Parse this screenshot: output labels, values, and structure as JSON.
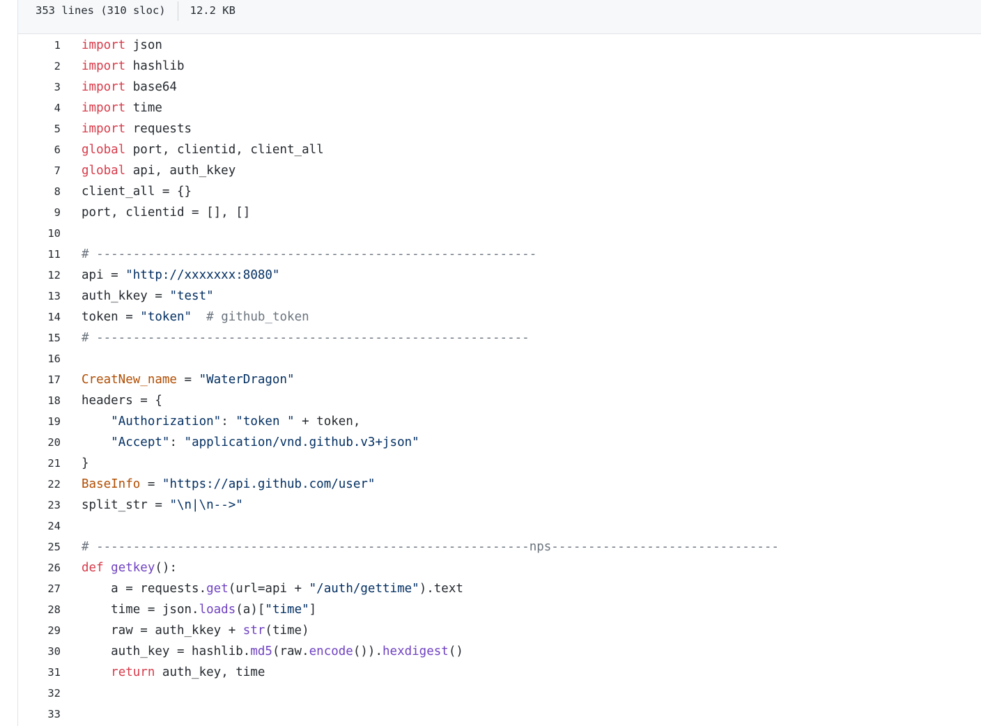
{
  "file_info": {
    "lines": "353 lines (310 sloc)",
    "size": "12.2 KB"
  },
  "code_lines": [
    {
      "n": "1",
      "tokens": [
        [
          "kw",
          "import"
        ],
        [
          "p",
          " json"
        ]
      ]
    },
    {
      "n": "2",
      "tokens": [
        [
          "kw",
          "import"
        ],
        [
          "p",
          " hashlib"
        ]
      ]
    },
    {
      "n": "3",
      "tokens": [
        [
          "kw",
          "import"
        ],
        [
          "p",
          " base64"
        ]
      ]
    },
    {
      "n": "4",
      "tokens": [
        [
          "kw",
          "import"
        ],
        [
          "p",
          " time"
        ]
      ]
    },
    {
      "n": "5",
      "tokens": [
        [
          "kw",
          "import"
        ],
        [
          "p",
          " requests"
        ]
      ]
    },
    {
      "n": "6",
      "tokens": [
        [
          "kw",
          "global"
        ],
        [
          "p",
          " port, clientid, client_all"
        ]
      ]
    },
    {
      "n": "7",
      "tokens": [
        [
          "kw",
          "global"
        ],
        [
          "p",
          " api, auth_kkey"
        ]
      ]
    },
    {
      "n": "8",
      "tokens": [
        [
          "p",
          "client_all = {}"
        ]
      ]
    },
    {
      "n": "9",
      "tokens": [
        [
          "p",
          "port, clientid = [], []"
        ]
      ]
    },
    {
      "n": "10",
      "tokens": []
    },
    {
      "n": "11",
      "tokens": [
        [
          "com",
          "# ------------------------------------------------------------"
        ]
      ]
    },
    {
      "n": "12",
      "tokens": [
        [
          "p",
          "api = "
        ],
        [
          "str",
          "\"http://xxxxxxx:8080\""
        ]
      ]
    },
    {
      "n": "13",
      "tokens": [
        [
          "p",
          "auth_kkey = "
        ],
        [
          "str",
          "\"test\""
        ]
      ]
    },
    {
      "n": "14",
      "tokens": [
        [
          "p",
          "token = "
        ],
        [
          "str",
          "\"token\""
        ],
        [
          "p",
          "  "
        ],
        [
          "com",
          "# github_token"
        ]
      ]
    },
    {
      "n": "15",
      "tokens": [
        [
          "com",
          "# -----------------------------------------------------------"
        ]
      ]
    },
    {
      "n": "16",
      "tokens": []
    },
    {
      "n": "17",
      "tokens": [
        [
          "var2",
          "CreatNew_name"
        ],
        [
          "p",
          " = "
        ],
        [
          "str",
          "\"WaterDragon\""
        ]
      ]
    },
    {
      "n": "18",
      "tokens": [
        [
          "p",
          "headers = {"
        ]
      ]
    },
    {
      "n": "19",
      "tokens": [
        [
          "p",
          "    "
        ],
        [
          "str",
          "\"Authorization\""
        ],
        [
          "p",
          ": "
        ],
        [
          "str",
          "\"token \""
        ],
        [
          "p",
          " + token,"
        ]
      ]
    },
    {
      "n": "20",
      "tokens": [
        [
          "p",
          "    "
        ],
        [
          "str",
          "\"Accept\""
        ],
        [
          "p",
          ": "
        ],
        [
          "str",
          "\"application/vnd.github.v3+json\""
        ]
      ]
    },
    {
      "n": "21",
      "tokens": [
        [
          "p",
          "}"
        ]
      ]
    },
    {
      "n": "22",
      "tokens": [
        [
          "var2",
          "BaseInfo"
        ],
        [
          "p",
          " = "
        ],
        [
          "str",
          "\"https://api.github.com/user\""
        ]
      ]
    },
    {
      "n": "23",
      "tokens": [
        [
          "p",
          "split_str = "
        ],
        [
          "str",
          "\"\\n|\\n-->\""
        ]
      ]
    },
    {
      "n": "24",
      "tokens": []
    },
    {
      "n": "25",
      "tokens": [
        [
          "com",
          "# -----------------------------------------------------------nps-------------------------------"
        ]
      ]
    },
    {
      "n": "26",
      "tokens": [
        [
          "kw",
          "def"
        ],
        [
          "p",
          " "
        ],
        [
          "fn",
          "getkey"
        ],
        [
          "p",
          "():"
        ]
      ]
    },
    {
      "n": "27",
      "tokens": [
        [
          "p",
          "    a = requests."
        ],
        [
          "fn",
          "get"
        ],
        [
          "p",
          "(url=api + "
        ],
        [
          "str",
          "\"/auth/gettime\""
        ],
        [
          "p",
          ").text"
        ]
      ]
    },
    {
      "n": "28",
      "tokens": [
        [
          "p",
          "    time = json."
        ],
        [
          "fn",
          "loads"
        ],
        [
          "p",
          "(a)["
        ],
        [
          "str",
          "\"time\""
        ],
        [
          "p",
          "]"
        ]
      ]
    },
    {
      "n": "29",
      "tokens": [
        [
          "p",
          "    raw = auth_kkey + "
        ],
        [
          "fn",
          "str"
        ],
        [
          "p",
          "(time)"
        ]
      ]
    },
    {
      "n": "30",
      "tokens": [
        [
          "p",
          "    auth_key = hashlib."
        ],
        [
          "fn",
          "md5"
        ],
        [
          "p",
          "(raw."
        ],
        [
          "fn",
          "encode"
        ],
        [
          "p",
          "())."
        ],
        [
          "fn",
          "hexdigest"
        ],
        [
          "p",
          "()"
        ]
      ]
    },
    {
      "n": "31",
      "tokens": [
        [
          "p",
          "    "
        ],
        [
          "kw",
          "return"
        ],
        [
          "p",
          " auth_key, time"
        ]
      ]
    },
    {
      "n": "32",
      "tokens": []
    },
    {
      "n": "33",
      "tokens": []
    }
  ]
}
